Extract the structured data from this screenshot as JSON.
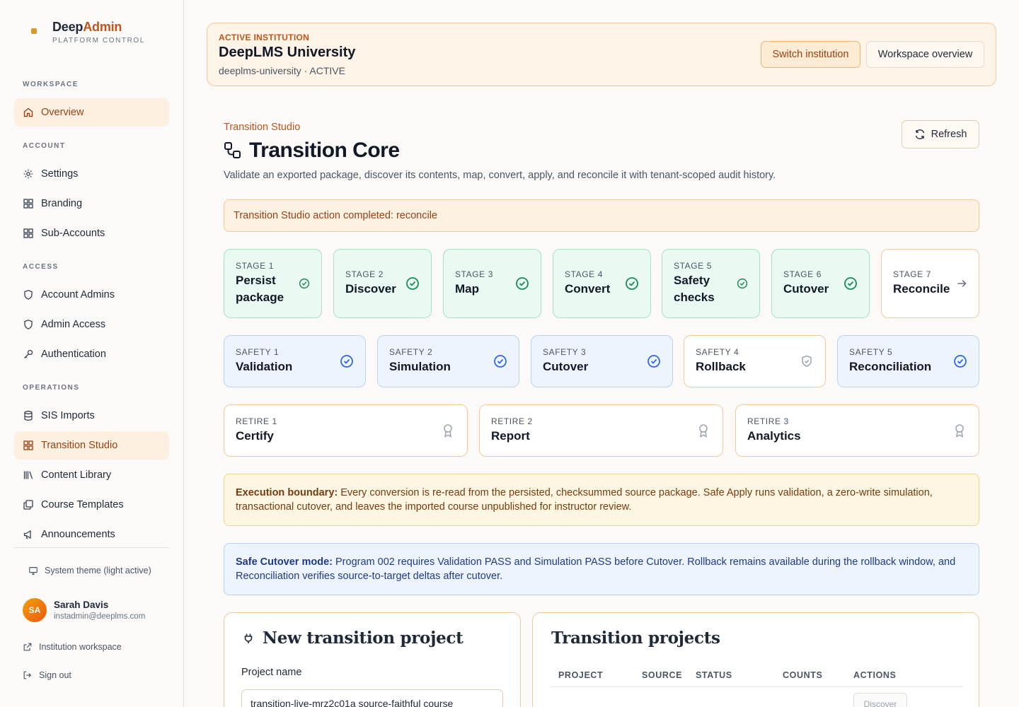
{
  "brand": {
    "name_main": "Deep",
    "name_accent": "Admin",
    "subtitle": "PLATFORM CONTROL"
  },
  "sidebar": {
    "sections": {
      "workspace": "WORKSPACE",
      "account": "ACCOUNT",
      "access": "ACCESS",
      "operations": "OPERATIONS"
    },
    "items": {
      "overview": "Overview",
      "settings": "Settings",
      "branding": "Branding",
      "sub_accounts": "Sub-Accounts",
      "account_admins": "Account Admins",
      "admin_access": "Admin Access",
      "authentication": "Authentication",
      "sis_imports": "SIS Imports",
      "transition_studio": "Transition Studio",
      "content_library": "Content Library",
      "course_templates": "Course Templates",
      "announcements": "Announcements"
    },
    "active_item": "Transition Studio",
    "theme_toggle": "System theme (light active)",
    "user": {
      "initials": "SA",
      "name": "Sarah Davis",
      "email": "instadmin@deeplms.com"
    },
    "institution_workspace": "Institution workspace",
    "sign_out": "Sign out"
  },
  "institution": {
    "label": "ACTIVE INSTITUTION",
    "name": "DeepLMS University",
    "slug_status": "deeplms-university · ACTIVE",
    "switch_button": "Switch institution",
    "overview_button": "Workspace overview"
  },
  "page": {
    "breadcrumb": "Transition Studio",
    "title": "Transition Core",
    "description": "Validate an exported package, discover its contents, map, convert, apply, and reconcile it with tenant-scoped audit history.",
    "refresh_button": "Refresh",
    "alert": "Transition Studio action completed: reconcile"
  },
  "stages": [
    {
      "kicker": "STAGE 1",
      "title": "Persist package",
      "state": "complete"
    },
    {
      "kicker": "STAGE 2",
      "title": "Discover",
      "state": "complete"
    },
    {
      "kicker": "STAGE 3",
      "title": "Map",
      "state": "complete"
    },
    {
      "kicker": "STAGE 4",
      "title": "Convert",
      "state": "complete"
    },
    {
      "kicker": "STAGE 5",
      "title": "Safety checks",
      "state": "complete"
    },
    {
      "kicker": "STAGE 6",
      "title": "Cutover",
      "state": "complete"
    },
    {
      "kicker": "STAGE 7",
      "title": "Reconcile",
      "state": "next"
    }
  ],
  "safety": [
    {
      "kicker": "SAFETY 1",
      "title": "Validation",
      "state": "complete"
    },
    {
      "kicker": "SAFETY 2",
      "title": "Simulation",
      "state": "complete"
    },
    {
      "kicker": "SAFETY 3",
      "title": "Cutover",
      "state": "complete"
    },
    {
      "kicker": "SAFETY 4",
      "title": "Rollback",
      "state": "available"
    },
    {
      "kicker": "SAFETY 5",
      "title": "Reconciliation",
      "state": "complete"
    }
  ],
  "retire": [
    {
      "kicker": "RETIRE 1",
      "title": "Certify"
    },
    {
      "kicker": "RETIRE 2",
      "title": "Report"
    },
    {
      "kicker": "RETIRE 3",
      "title": "Analytics"
    }
  ],
  "notices": {
    "execution_label": "Execution boundary:",
    "execution_text": " Every conversion is re-read from the persisted, checksummed source package. Safe Apply runs validation, a zero-write simulation, transactional cutover, and leaves the imported course unpublished for instructor review.",
    "cutover_label": "Safe Cutover mode:",
    "cutover_text": " Program 002 requires Validation PASS and Simulation PASS before Cutover. Rollback remains available during the rollback window, and Reconciliation verifies source-to-target deltas after cutover."
  },
  "new_project": {
    "title": "New transition project",
    "project_name_label": "Project name",
    "project_name_value": "transition-live-mrz2c01a source-faithful course"
  },
  "projects": {
    "title": "Transition projects",
    "columns": [
      "PROJECT",
      "SOURCE",
      "STATUS",
      "COUNTS",
      "ACTIONS"
    ],
    "first_row_action": "Discover"
  },
  "colors": {
    "accent": "#c2541b",
    "stage_complete": "#1a8a5a",
    "safety_complete": "#2563eb",
    "banner_bg": "#fdf3e6"
  }
}
